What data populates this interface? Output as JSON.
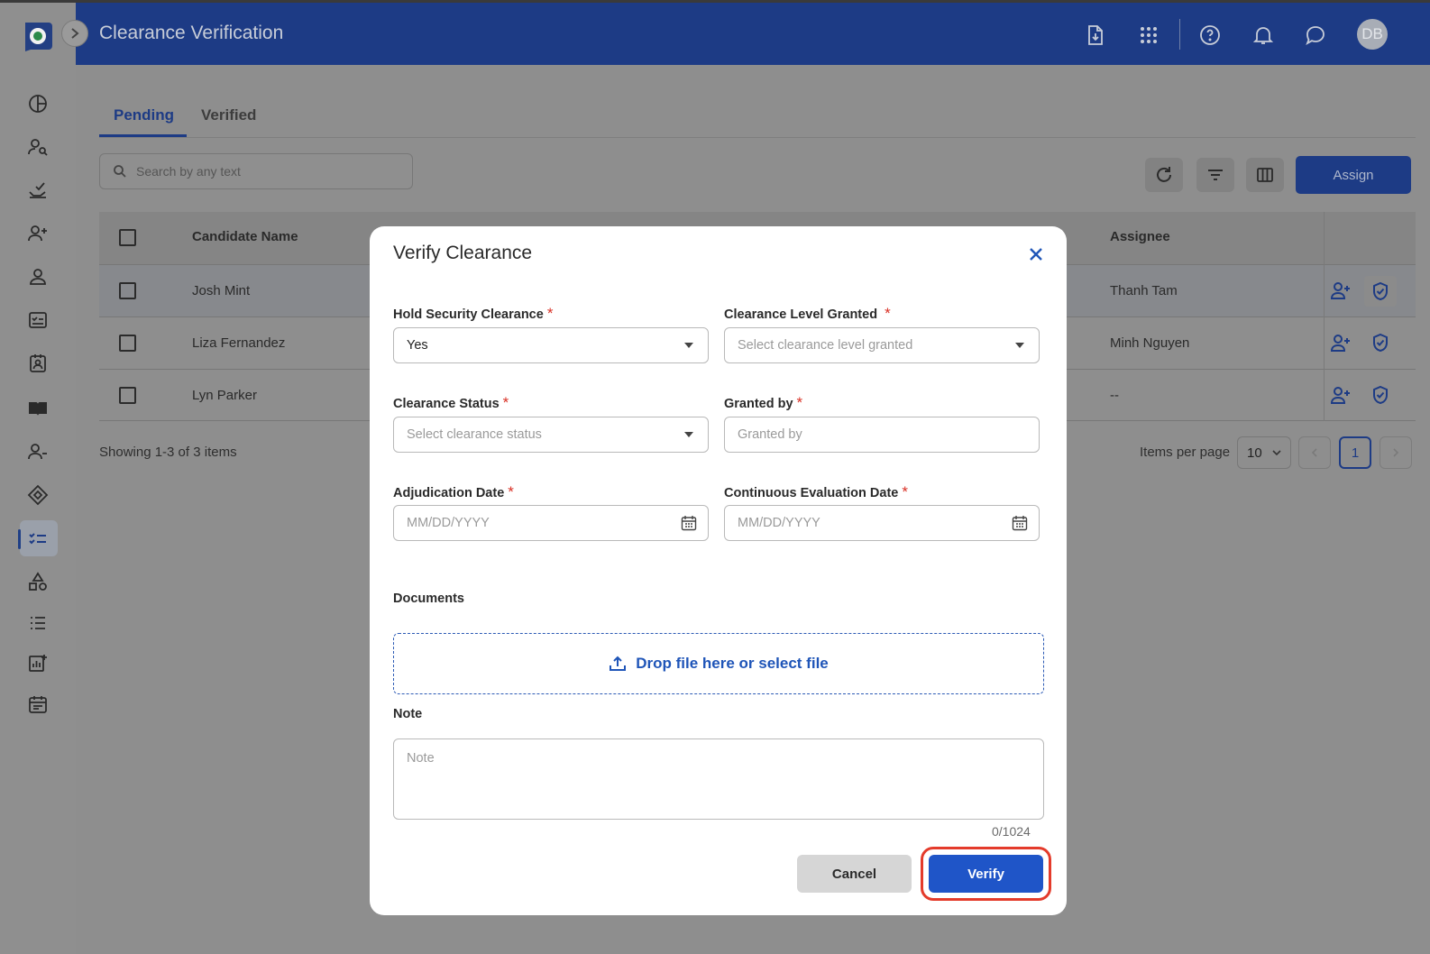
{
  "header": {
    "title": "Clearance Verification",
    "avatar_initials": "DB",
    "icons": [
      "download-file-icon",
      "apps-grid-icon",
      "help-icon",
      "notification-bell-icon",
      "chat-icon"
    ]
  },
  "sidebar": {
    "icons": [
      "dashboard-icon",
      "candidate-search-icon",
      "handshake-check-icon",
      "add-user-icon",
      "user-icon",
      "checklist-icon",
      "badge-icon",
      "book-icon",
      "user-remove-icon",
      "tag-icon",
      "clearance-list-icon",
      "shapes-icon",
      "list-icon",
      "report-icon",
      "calendar-icon"
    ],
    "active_index": 10
  },
  "tabs": {
    "pending": "Pending",
    "verified": "Verified"
  },
  "search": {
    "placeholder": "Search by any text"
  },
  "toolbar": {
    "assign_label": "Assign"
  },
  "table": {
    "columns": {
      "candidate": "Candidate Name",
      "assignee": "Assignee"
    },
    "rows": [
      {
        "name": "Josh Mint",
        "assignee": "Thanh Tam"
      },
      {
        "name": "Liza Fernandez",
        "assignee": "Minh Nguyen"
      },
      {
        "name": "Lyn Parker",
        "assignee": "--"
      }
    ]
  },
  "footer": {
    "showing": "Showing 1-3 of 3 items",
    "items_per_page_label": "Items per page",
    "items_per_page_value": "10",
    "current_page": "1"
  },
  "modal": {
    "title": "Verify Clearance",
    "hold_label": "Hold Security Clearance",
    "hold_value": "Yes",
    "level_label": "Clearance Level Granted",
    "level_placeholder": "Select clearance level granted",
    "status_label": "Clearance Status",
    "status_placeholder": "Select clearance status",
    "granted_label": "Granted by",
    "granted_placeholder": "Granted by",
    "adjudication_label": "Adjudication Date",
    "adjudication_placeholder": "MM/DD/YYYY",
    "ce_label": "Continuous Evaluation Date",
    "ce_placeholder": "MM/DD/YYYY",
    "documents_label": "Documents",
    "dropzone_text": "Drop file here or select file",
    "note_label": "Note",
    "note_placeholder": "Note",
    "note_counter": "0/1024",
    "cancel_label": "Cancel",
    "verify_label": "Verify",
    "required_mark": "*"
  },
  "colors": {
    "brand": "#1d3b85",
    "primary_button": "#1f55c8",
    "highlight_ring": "#e43b2b",
    "required": "#d93025"
  }
}
